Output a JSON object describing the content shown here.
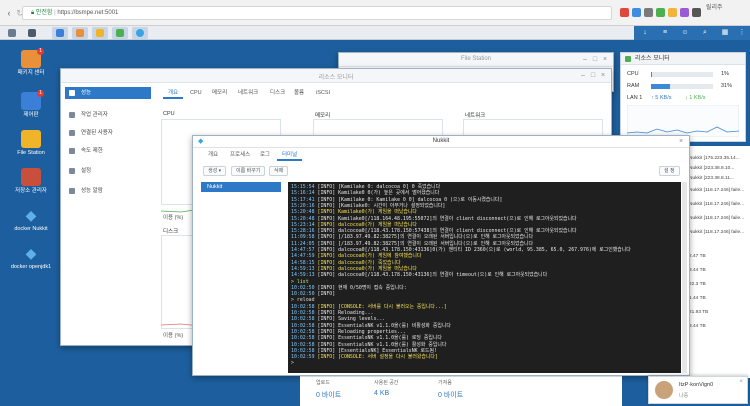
{
  "browser": {
    "secure_label": "안전함",
    "url": "https://bsmpe.net:5001",
    "user": "릴리주"
  },
  "desktop": {
    "icons": [
      {
        "label": "패키지 센터",
        "badge": "1",
        "color": "#e8913a"
      },
      {
        "label": "제어판",
        "badge": "1",
        "color": "#3c7fd8"
      },
      {
        "label": "File Station",
        "badge": "",
        "color": "#f0b429"
      },
      {
        "label": "저장소 관리자",
        "badge": "",
        "color": "#c84f3c"
      },
      {
        "label": "docker Nukkit",
        "badge": "",
        "color": "#5db0e8"
      },
      {
        "label": "docker openjdk1",
        "badge": "",
        "color": "#5db0e8"
      }
    ]
  },
  "widget": {
    "title": "리소스 모니터",
    "cpu_label": "CPU",
    "cpu_value": "1%",
    "cpu_fraction": 0.01,
    "ram_label": "RAM",
    "ram_value": "31%",
    "ram_fraction": 0.31,
    "lan_label": "LAN 1",
    "lan_up": "5 KB/s",
    "lan_down": "1 KB/s"
  },
  "file_station": {
    "title": "File Station"
  },
  "resource_monitor": {
    "title": "리소스 모니터",
    "tabs": [
      "개요",
      "CPU",
      "메모리",
      "네트워크",
      "디스크",
      "볼륨",
      "iSCSI"
    ],
    "sidebar": [
      "성능",
      "작업 관리자",
      "연결된 사용자",
      "속도 제한",
      "설정",
      "성능 알람"
    ],
    "panels": [
      "CPU",
      "메모리",
      "네트워크"
    ],
    "usage_label": "이용 (%)",
    "disk_label": "디스크"
  },
  "right_log": [
    "Nukkit [175.223.35.14...",
    "Nukkit [223.38.8.10...",
    "Nukkit [223.38.8.11...",
    "Nukkit [118.17.246] faile...",
    "Nukkit [118.17.246] faile...",
    "Nukkit [118.17.246] faile...",
    "Nukkit [118.17.246] faile..."
  ],
  "right_stats": [
    "2.47 TB",
    "3.44 TB",
    "22.3 TB",
    "1.44 TB",
    "21.93 TB",
    "3.44 TB"
  ],
  "nukkit": {
    "title": "Nukkit",
    "tabs": [
      "개요",
      "프로세스",
      "로그",
      "터미널"
    ],
    "active_tab": "터미널",
    "buttons": [
      "생성",
      "이름 바꾸기",
      "삭제"
    ],
    "session": "Nukkit",
    "settings_button": "설 정"
  },
  "console": [
    {
      "t": "15:15:54",
      "m": " [INFO] [Kamilake 0: dalcocoa 0] 0 죽었습니다",
      "c": "info"
    },
    {
      "t": "15:16:14",
      "m": " [INFO] Kamilake0 0(가) 높은 곳에서 떨어졌습니다",
      "c": "info"
    },
    {
      "t": "15:17:41",
      "m": " [INFO] [Kamilake 0: Kamilake 0 0] dalcocoa 0 (으)로 이동시켰습니다]",
      "c": "info"
    },
    {
      "t": "15:20:16",
      "m": " [INFO] [Kamilake0: 시간이 아무거나 설정되었습니다]",
      "c": "info"
    },
    {
      "t": "15:20:48",
      "m": " [INFO] Kamilake0(가) 게임을 떠났습니다",
      "c": "y"
    },
    {
      "t": "15:20:48",
      "m": " [INFO] Kamilake0[/118.164.48.195:55072]의 연결이 client disconnect(으)로 인해 로그아웃되었습니다",
      "c": "info"
    },
    {
      "t": "15:23:14",
      "m": " [INFO] dalcocoa0(가) 게임을 떠났습니다",
      "c": "y"
    },
    {
      "t": "15:28:16",
      "m": " [INFO] dalcocoa0[/118.43.178.150:57438]의 연결이 client disconnect(으)로 인해 로그아웃되었습니다",
      "c": "info"
    },
    {
      "t": "11:09:58",
      "m": " [INFO] [/183.97.49.82:38275]의 연결이 오래된 서버입니다(으)로 인해 로그아웃되었습니다",
      "c": "info"
    },
    {
      "t": "11:24:05",
      "m": " [INFO] [/183.97.49.82:38275]의 연결이 오래된 서버입니다(으)로 인해 로그아웃되었습니다",
      "c": "info"
    },
    {
      "t": "14:47:57",
      "m": " [INFO] dalcocoa0[/118.43.178.150:43136]0(가) 엔티티 ID 2360(으)로 (world, 95.385, 65.0, 267.976)에 로그인했습니다",
      "c": "info"
    },
    {
      "t": "14:47:59",
      "m": " [INFO] dalcocoa0(가) 게임에 참여했습니다",
      "c": "y"
    },
    {
      "t": "14:58:15",
      "m": " [INFO] dalcocoa0(가) 죽었습니다",
      "c": "y"
    },
    {
      "t": "14:59:13",
      "m": " [INFO] dalcocoa0(가) 게임을 떠났습니다",
      "c": "y"
    },
    {
      "t": "14:59:13",
      "m": " [INFO] dalcocoa0[/118.43.178.150:43136]의 연결이 timeout(으)로 인해 로그아웃되었습니다",
      "c": "info"
    },
    {
      "t": "",
      "m": "> list",
      "c": "g"
    },
    {
      "t": "10:02:50",
      "m": " [INFO] 현재 0/50명이 접속 중입니다:",
      "c": "info"
    },
    {
      "t": "10:02:50",
      "m": " [INFO]",
      "c": "info"
    },
    {
      "t": "",
      "m": "> reload",
      "c": "w"
    },
    {
      "t": "10:02:58",
      "m": " [INFO] [CONSOLE: 서버를 다시 불러오는 중입니다...]",
      "c": "y"
    },
    {
      "t": "10:02:58",
      "m": " [INFO] Reloading...",
      "c": "info"
    },
    {
      "t": "10:02:58",
      "m": " [INFO] Saving levels...",
      "c": "info"
    },
    {
      "t": "10:02:58",
      "m": " [INFO] EssentialsNK v1.1.0을(를) 비활성화 중입니다",
      "c": "info"
    },
    {
      "t": "10:02:58",
      "m": " [INFO] Reloading properties...",
      "c": "info"
    },
    {
      "t": "10:02:58",
      "m": " [INFO] EssentialsNK v1.1.0을(를) 로딩 중입니다",
      "c": "info"
    },
    {
      "t": "10:02:58",
      "m": " [INFO] EssentialsNK v1.1.0을(를) 활성화 중입니다",
      "c": "info"
    },
    {
      "t": "10:02:58",
      "m": " [INFO] [EssentialsNK] EssentialsNK 로드됨!",
      "c": "info"
    },
    {
      "t": "10:02:59",
      "m": " [INFO] [CONSOLE: 서버 설정을 다시 불러왔습니다]",
      "c": "y"
    },
    {
      "t": "",
      "m": ">",
      "c": "w"
    }
  ],
  "bottom": {
    "cells": [
      {
        "label": "업로드",
        "value": "0 바이트"
      },
      {
        "label": "사용된 공간",
        "value": "4 KB"
      },
      {
        "label": "가져옴",
        "value": "0 바이트"
      }
    ]
  },
  "notification": {
    "user": "ItzP·konVign0",
    "sub": "나중"
  },
  "colors": {
    "accent": "#2e79c7",
    "desktop": "#1d5f9e",
    "console_bg": "#1f1f1f"
  }
}
